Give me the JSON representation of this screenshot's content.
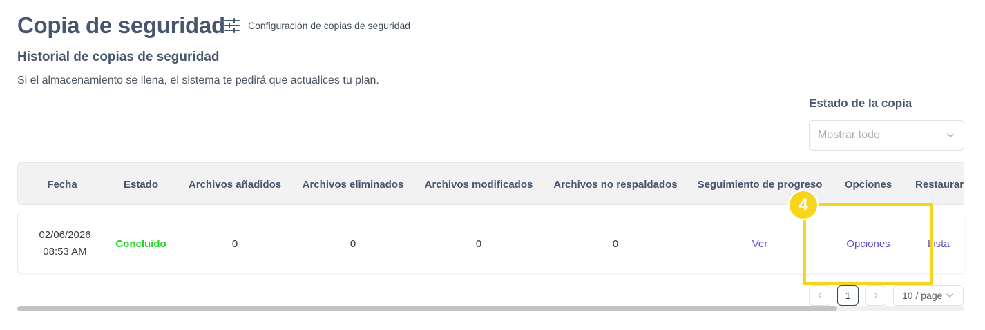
{
  "header": {
    "title": "Copia de seguridad",
    "settings_icon": "sliders-icon",
    "settings_label": "Configuración de copias de seguridad"
  },
  "history": {
    "title": "Historial de copias de seguridad",
    "hint": "Si el almacenamiento se llena, el sistema te pedirá que actualices tu plan."
  },
  "filter": {
    "label": "Estado de la copia",
    "placeholder": "Mostrar todo"
  },
  "table": {
    "columns": [
      "Fecha",
      "Estado",
      "Archivos añadidos",
      "Archivos eliminados",
      "Archivos modificados",
      "Archivos no respaldados",
      "Seguimiento de progreso",
      "Opciones",
      "Restaurar"
    ],
    "rows": [
      {
        "date": "02/06/2026",
        "time": "08:53 AM",
        "status": "Concluido",
        "added": "0",
        "deleted": "0",
        "modified": "0",
        "not_backed_up": "0",
        "progress_link": "Ver",
        "options_link": "Opciones",
        "restore_link": "Lista"
      }
    ]
  },
  "pagination": {
    "current_page": "1",
    "page_size": "10 / page"
  },
  "annotation": {
    "step": "4"
  },
  "colors": {
    "title": "#46566e",
    "status_done": "#22d626",
    "link": "#5b4fc9",
    "highlight": "#f7d51d"
  }
}
